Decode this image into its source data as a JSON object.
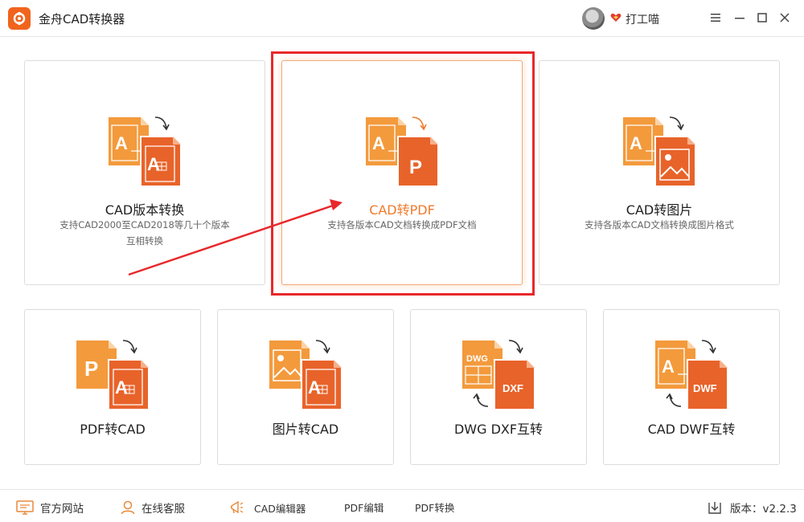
{
  "app": {
    "title": "金舟CAD转换器"
  },
  "user": {
    "name": "打工喵"
  },
  "window_controls": [
    "menu",
    "minimize",
    "maximize",
    "close"
  ],
  "cards": [
    {
      "title": "CAD版本转换",
      "desc_line1": "支持CAD2000至CAD2018等几十个版本",
      "desc_line2": "互相转换",
      "icon": "cad-version-convert-icon"
    },
    {
      "title": "CAD转PDF",
      "desc_line1": "支持各版本CAD文档转换成PDF文档",
      "desc_line2": "",
      "icon": "cad-to-pdf-icon",
      "selected": true
    },
    {
      "title": "CAD转图片",
      "desc_line1": "支持各版本CAD文档转换成图片格式",
      "desc_line2": "",
      "icon": "cad-to-image-icon"
    },
    {
      "title": "PDF转CAD",
      "icon": "pdf-to-cad-icon"
    },
    {
      "title": "图片转CAD",
      "icon": "image-to-cad-icon"
    },
    {
      "title": "DWG DXF互转",
      "icon": "dwg-dxf-convert-icon",
      "badge_top": "DWG",
      "badge_bottom": "DXF"
    },
    {
      "title": "CAD DWF互转",
      "icon": "cad-dwf-convert-icon",
      "badge_bottom": "DWF"
    }
  ],
  "bottom": {
    "website": "官方网站",
    "service": "在线客服",
    "cad_editor": "CAD编辑器",
    "pdf_editor": "PDF编辑",
    "pdf_convert": "PDF转换",
    "version": "版本：v2.2.3"
  },
  "icon_letters": {
    "a": "A",
    "p": "P"
  },
  "colors": {
    "accent": "#f07a2c",
    "highlight": "#e8282b",
    "doc_orange": "#f39a3c",
    "doc_dark": "#e8632a"
  }
}
